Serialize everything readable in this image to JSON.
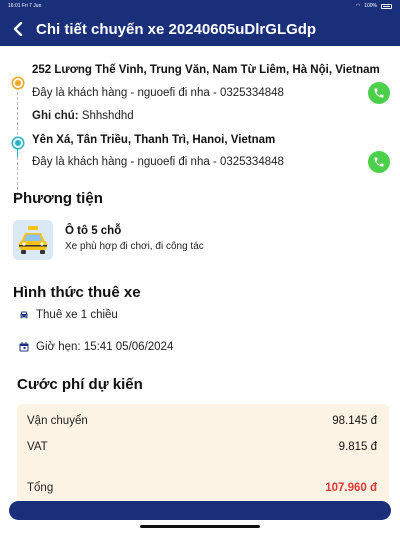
{
  "status_bar": {
    "time": "16:01",
    "date": "Fri 7 Jun",
    "battery": "100%"
  },
  "header": {
    "back_icon": "chevron-left-icon",
    "title": "Chi tiết chuyến xe 20240605uDlrGLGdp"
  },
  "route": {
    "origin": {
      "address": "252 Lương Thế Vinh, Trung Văn, Nam Từ Liêm, Hà Nội, Vietnam",
      "contact": "Đây là khách hàng - nguoefi đi nha - 0325334848"
    },
    "note_label": "Ghi chú:",
    "note_value": "Shhshdhd",
    "destination": {
      "address": "Yên Xá, Tân Triều, Thanh Trì, Hanoi, Vietnam",
      "contact": "Đây là khách hàng - nguoefi đi nha - 0325334848"
    }
  },
  "vehicle": {
    "section_title": "Phương tiện",
    "name": "Ô tô 5 chỗ",
    "description": "Xe phù hợp đi chơi, đi công tác"
  },
  "rental": {
    "section_title": "Hình thức thuê xe",
    "type": "Thuê xe 1 chiều",
    "appointment": "Giờ hẹn: 15:41 05/06/2024"
  },
  "fees": {
    "section_title": "Cước phí dự kiến",
    "rows": [
      {
        "label": "Vận chuyển",
        "value": "98.145 đ"
      },
      {
        "label": "VAT",
        "value": "9.815 đ"
      },
      {
        "label": "Tổng",
        "value": "107.960 đ"
      }
    ]
  },
  "colors": {
    "primary": "#1a2f7a",
    "phone_green": "#4cd04c",
    "total_red": "#e53935",
    "fee_bg": "#fdf3e4"
  }
}
